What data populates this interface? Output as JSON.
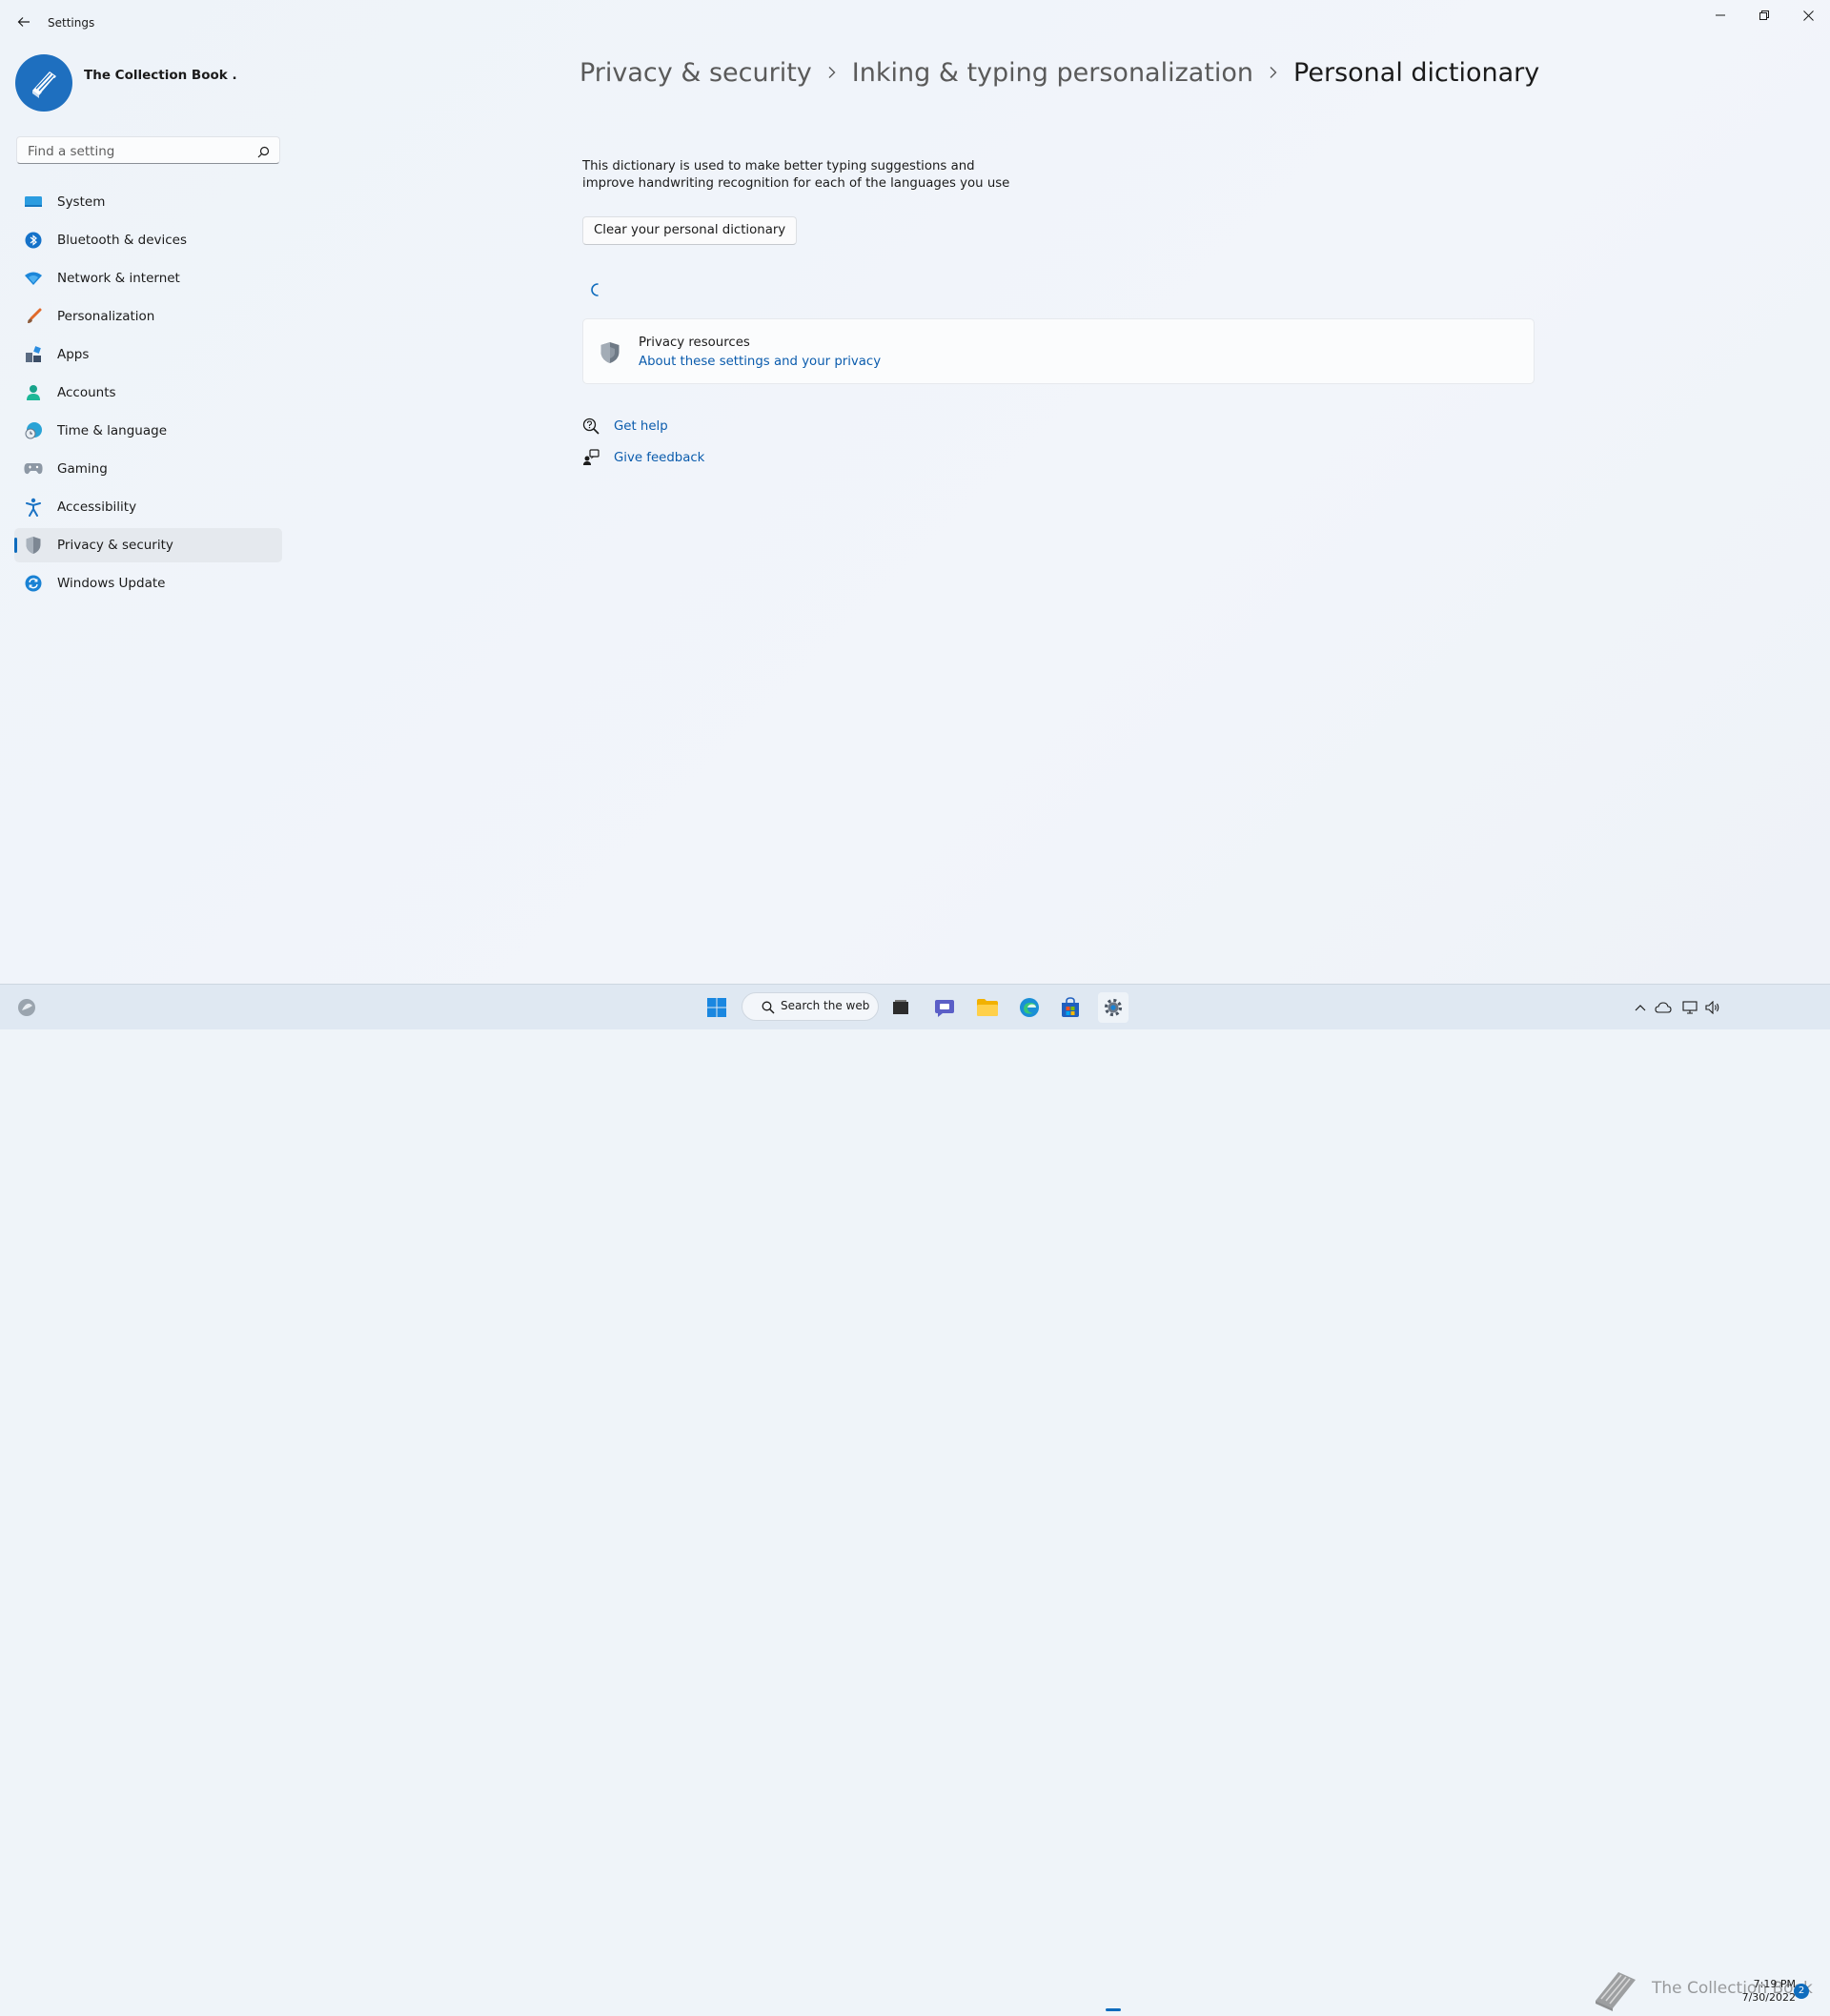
{
  "window": {
    "title": "Settings"
  },
  "profile": {
    "name": "The Collection Book ."
  },
  "search": {
    "placeholder": "Find a setting"
  },
  "nav": {
    "items": [
      {
        "label": "System",
        "icon": "system-icon"
      },
      {
        "label": "Bluetooth & devices",
        "icon": "bluetooth-icon"
      },
      {
        "label": "Network & internet",
        "icon": "wifi-icon"
      },
      {
        "label": "Personalization",
        "icon": "brush-icon"
      },
      {
        "label": "Apps",
        "icon": "apps-icon"
      },
      {
        "label": "Accounts",
        "icon": "account-icon"
      },
      {
        "label": "Time & language",
        "icon": "globe-clock-icon"
      },
      {
        "label": "Gaming",
        "icon": "controller-icon"
      },
      {
        "label": "Accessibility",
        "icon": "accessibility-icon"
      },
      {
        "label": "Privacy & security",
        "icon": "shield-icon",
        "active": true
      },
      {
        "label": "Windows Update",
        "icon": "update-icon"
      }
    ]
  },
  "breadcrumb": {
    "items": [
      "Privacy & security",
      "Inking & typing personalization",
      "Personal dictionary"
    ]
  },
  "main": {
    "description": "This dictionary is used to make better typing suggestions and improve handwriting recognition for each of the languages you use",
    "clear_button": "Clear your personal dictionary",
    "privacy_card": {
      "title": "Privacy resources",
      "link": "About these settings and your privacy"
    },
    "get_help": "Get help",
    "give_feedback": "Give feedback"
  },
  "taskbar": {
    "search_label": "Search the web",
    "time": "7:19 PM",
    "date": "7/30/2022",
    "notification_count": "2",
    "watermark": "The Collection Book"
  },
  "colors": {
    "accent": "#0f6cbd",
    "link": "#0b5cad",
    "background": "#eff4f9"
  }
}
